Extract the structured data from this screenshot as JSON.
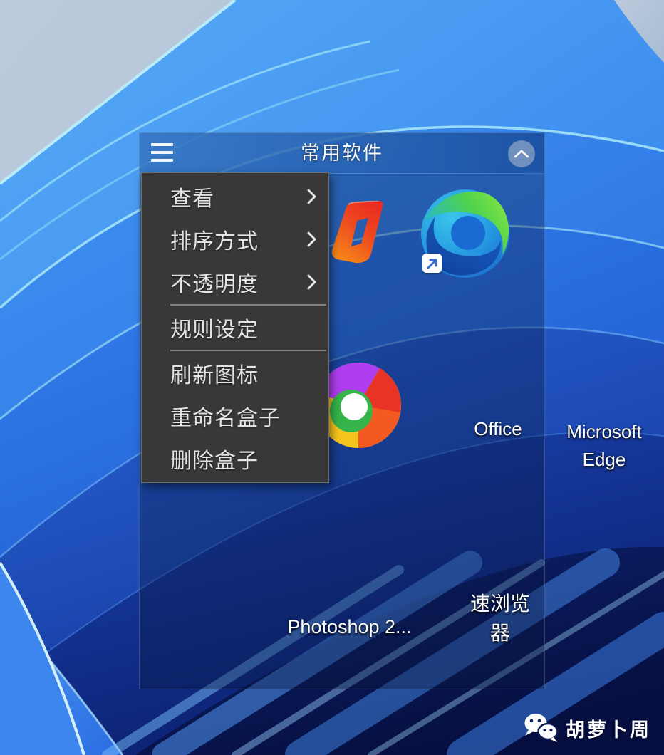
{
  "fence_box": {
    "title": "常用软件",
    "title_bar": {
      "menu_icon": "hamburger-menu-icon",
      "collapse_icon": "chevron-up-icon"
    },
    "icons": [
      {
        "label": "Office",
        "icon": "wps-office-icon",
        "shortcut": false
      },
      {
        "label": "Microsoft Edge",
        "icon": "microsoft-edge-icon",
        "shortcut": true
      },
      {
        "label": "速浏览器",
        "icon": "pinwheel-browser-icon",
        "shortcut": false
      },
      {
        "label": "Photoshop 2...",
        "icon": "photoshop-icon",
        "shortcut": false
      }
    ]
  },
  "context_menu": {
    "items": [
      {
        "label": "查看",
        "submenu": true
      },
      {
        "label": "排序方式",
        "submenu": true
      },
      {
        "label": "不透明度",
        "submenu": true
      },
      {
        "label": "规则设定",
        "submenu": false
      },
      {
        "label": "刷新图标",
        "submenu": false
      },
      {
        "label": "重命名盒子",
        "submenu": false
      },
      {
        "label": "删除盒子",
        "submenu": false
      }
    ]
  },
  "watermark": {
    "text": "胡萝卜周",
    "icon": "wechat-icon"
  },
  "colors": {
    "menu_bg": "#383838",
    "menu_text": "#e3e3e3",
    "fence_tint": "rgba(10,22,64,0.35)",
    "title_bar_blue": "#2a6fc4",
    "wallpaper_sky": "#b9c8da",
    "wallpaper_bright_blue": "#2d7ceb",
    "wallpaper_deep_navy": "#0a1b6b",
    "edge_cyan_highlight": "#b8ecfa"
  }
}
